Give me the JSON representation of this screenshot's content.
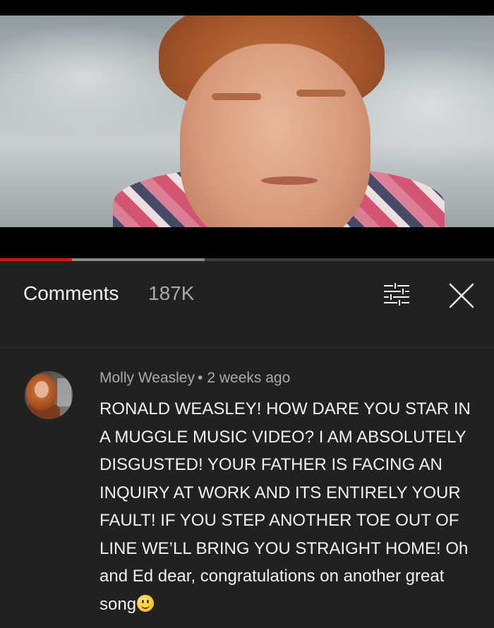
{
  "video": {
    "progress_played": 0.145,
    "progress_buffered": 0.414,
    "colors": {
      "played": "#ff0000",
      "buffered": "#8a8a8a"
    }
  },
  "comments_panel": {
    "title": "Comments",
    "count": "187K",
    "filter_icon": "sort-filter-icon",
    "close_icon": "close-icon"
  },
  "comment": {
    "author": "Molly Weasley",
    "separator": "•",
    "time": "2 weeks ago",
    "text": "RONALD WEASLEY! HOW DARE YOU STAR IN A MUGGLE MUSIC VIDEO? I AM ABSOLUTELY DISGUSTED! YOUR FATHER IS FACING AN INQUIRY AT WORK AND ITS ENTIRELY YOUR FAULT! IF YOU STEP ANOTHER TOE OUT OF LINE WE’LL BRING YOU STRAIGHT HOME! Oh and Ed dear, congratulations on another great song",
    "emoji": "smiling-face-emoji"
  }
}
